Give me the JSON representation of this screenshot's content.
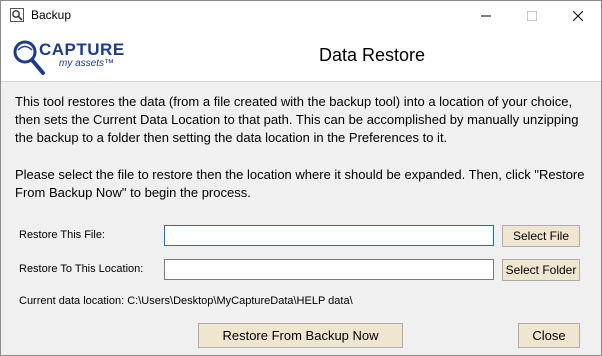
{
  "window": {
    "title": "Backup"
  },
  "header": {
    "logo_main": "CAPTURE",
    "logo_sub": "my assets™",
    "title": "Data Restore"
  },
  "description": {
    "paragraph1": "This tool restores the data (from a file created with the backup tool) into a location of your choice, then sets the Current Data Location to that path. This can be accomplished by manually unzipping the backup to a folder then setting the data location in the Preferences to it.",
    "paragraph2": "Please select the file to restore then the location where it should be expanded. Then, click \"Restore From Backup Now\" to begin the process."
  },
  "form": {
    "restore_file_label": "Restore This File:",
    "restore_file_value": "",
    "select_file_label": "Select File",
    "restore_location_label": "Restore To This Location:",
    "restore_location_value": "",
    "select_folder_label": "Select Folder",
    "current_location_text": "Current data location: C:\\Users\\Desktop\\MyCaptureData\\HELP data\\"
  },
  "actions": {
    "restore_label": "Restore From Backup Now",
    "close_label": "Close"
  },
  "icons": {
    "app": "app-icon",
    "minimize": "minimize-icon",
    "maximize": "maximize-icon",
    "close": "close-icon",
    "logo_magnifier": "magnifier-icon"
  },
  "colors": {
    "button_face": "#f0e6d0",
    "input_focus_border": "#0078d7",
    "logo_blue": "#1e3a8a"
  }
}
